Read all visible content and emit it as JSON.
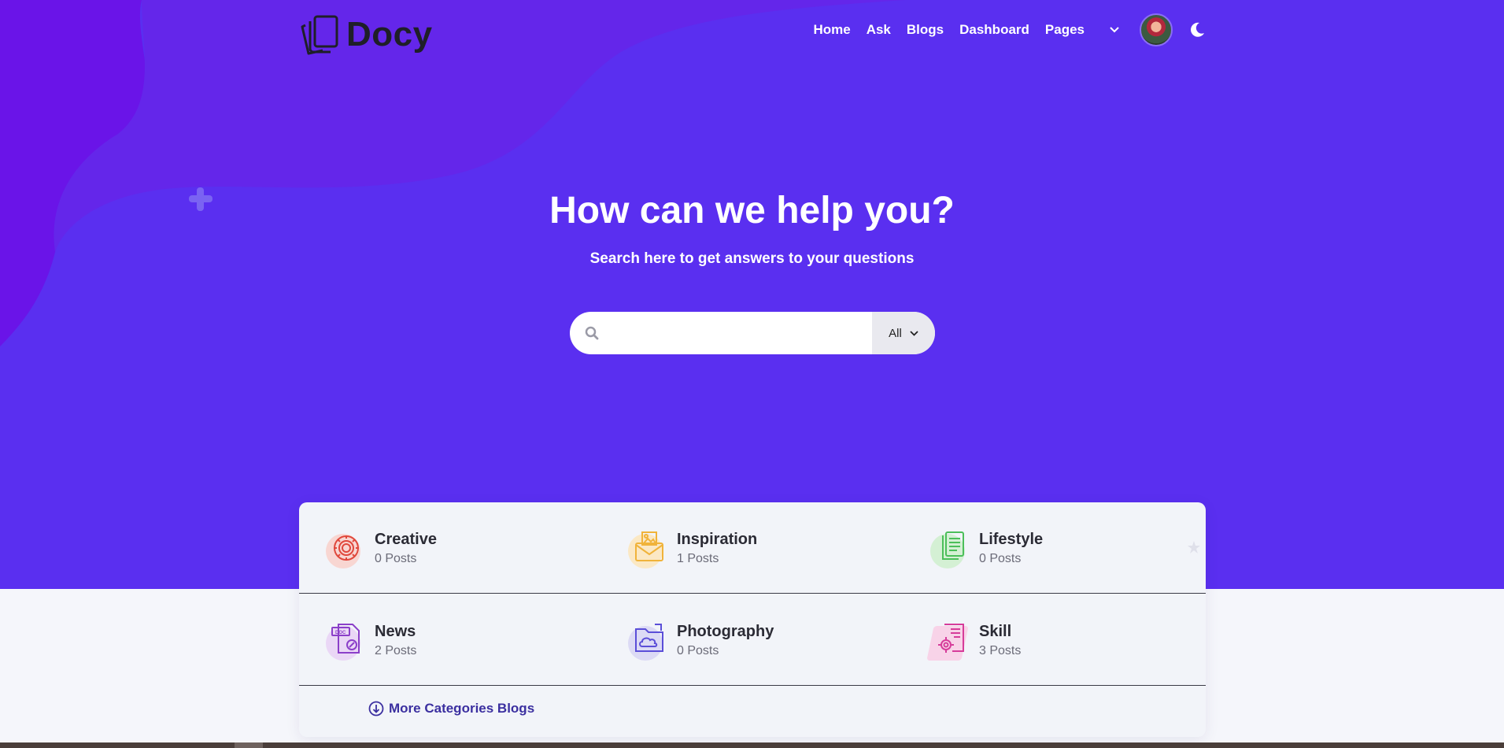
{
  "brand": {
    "name": "Docy"
  },
  "nav": {
    "links": [
      "Home",
      "Ask",
      "Blogs",
      "Dashboard",
      "Pages"
    ]
  },
  "hero": {
    "title": "How can we help you?",
    "subtitle": "Search here to get answers to your questions"
  },
  "search": {
    "placeholder": "",
    "value": "",
    "filter_selected": "All"
  },
  "categories": [
    {
      "name": "Creative",
      "count": "0 Posts",
      "icon": "gear-icon",
      "color": "#e0483c"
    },
    {
      "name": "Inspiration",
      "count": "1 Posts",
      "icon": "envelope-image-icon",
      "color": "#f0b33a"
    },
    {
      "name": "Lifestyle",
      "count": "0 Posts",
      "icon": "documents-icon",
      "color": "#4cbf5a"
    },
    {
      "name": "News",
      "count": "2 Posts",
      "icon": "doc-file-icon",
      "color": "#8b3fc9"
    },
    {
      "name": "Photography",
      "count": "0 Posts",
      "icon": "cloud-folder-icon",
      "color": "#5b4ed8"
    },
    {
      "name": "Skill",
      "count": "3 Posts",
      "icon": "settings-document-icon",
      "color": "#d63c9a"
    }
  ],
  "more_categories": {
    "label": "More Categories Blogs"
  },
  "colors": {
    "hero_bg": "#5a2ff0",
    "accent_text": "#3b2fa0",
    "page_bg": "#f5f6fb"
  }
}
